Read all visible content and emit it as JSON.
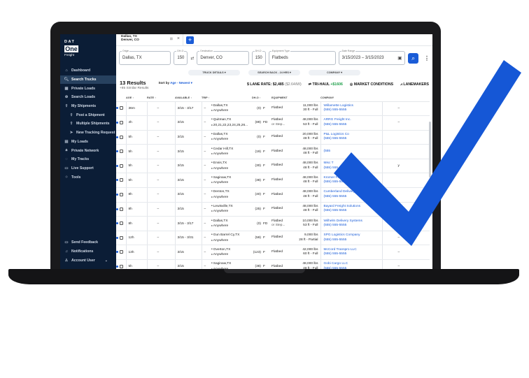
{
  "app": {
    "dat": "DAT",
    "one": "One",
    "freight": "Freight"
  },
  "sidebar": {
    "items": [
      {
        "label": "Dashboard",
        "icon": "home-icon",
        "glyph": "⌂"
      },
      {
        "label": "Search Trucks",
        "icon": "search-icon",
        "glyph": "🔍︎",
        "active": true
      },
      {
        "label": "Private Loads",
        "icon": "building-icon",
        "glyph": "▦"
      },
      {
        "label": "Search Loads",
        "icon": "search-loads-icon",
        "glyph": "⊕"
      },
      {
        "label": "My Shipments",
        "icon": "upload-icon",
        "glyph": "⇧"
      },
      {
        "label": "Post a Shipment",
        "icon": "upload-icon",
        "glyph": "⇧",
        "sub": true
      },
      {
        "label": "Multiple Shipments",
        "icon": "upload-icon",
        "glyph": "⇧",
        "sub": true
      },
      {
        "label": "New Tracking Request",
        "icon": "send-icon",
        "glyph": "➤",
        "sub": true
      },
      {
        "label": "My Loads",
        "icon": "truck-icon",
        "glyph": "▤"
      },
      {
        "label": "Private Network",
        "icon": "lock-icon",
        "glyph": "🔒︎"
      },
      {
        "label": "My Tracks",
        "icon": "tracks-icon",
        "glyph": "◌"
      },
      {
        "label": "Live Support",
        "icon": "chat-icon",
        "glyph": "▭"
      },
      {
        "label": "Tools",
        "icon": "tools-icon",
        "glyph": "⁘"
      }
    ],
    "bottom": [
      {
        "label": "Send Feedback",
        "icon": "feedback-icon",
        "glyph": "▭"
      },
      {
        "label": "Notifications",
        "icon": "bell-icon",
        "glyph": "♫"
      },
      {
        "label": "Account User",
        "icon": "user-icon",
        "glyph": "♙"
      }
    ]
  },
  "tab": {
    "origin": "Dallas, TX",
    "destination": "Denver, CO"
  },
  "search": {
    "origin_label": "Origin",
    "origin": "Dallas, TX",
    "dho_label": "DH-O",
    "dho": "150",
    "destination_label": "Destination",
    "destination": "Denver, CO",
    "dhd_label": "DH-D",
    "dhd": "150",
    "equipment_label": "Equipment Type",
    "equipment": "Flatbeds",
    "date_label": "Date Range",
    "date": "3/15/2023 – 3/15/2023"
  },
  "chips": [
    "TRUCK DETAILS ▾",
    "SEARCH BACK - 24 HRS ▾",
    "COMPANY ▾"
  ],
  "results": {
    "count": "13 Results",
    "similar": "+85 Similar Results",
    "sort_prefix": "Sort by",
    "sort_value": "Age - Newest ▾",
    "lane_rate_prefix": "$ LANE RATE:",
    "lane_rate": "$2,485",
    "lane_rate_per_mile": "($2.64/MI)",
    "tri_haul_prefix": "⇄ TRI-HAUL",
    "tri_haul": "+$1606",
    "market": "◎ MARKET CONDITIONS",
    "lanemakers": "⩘ LANEMAKERS"
  },
  "columns": {
    "age": "AGE ↑",
    "rate": "RATE ↑",
    "available": "AVAILABLE ↑",
    "trip": "TRIP ↑",
    "dho": "DH-O ↑",
    "equipment": "EQUIPMENT",
    "company": "COMPANY"
  },
  "rows": [
    {
      "age": "36m",
      "rate": "–",
      "avail": "3/15 - 3/17",
      "trip": "–",
      "origin": "Dallas,TX",
      "dest": "Anywhere",
      "dho": "(0)",
      "eq": "F",
      "eqname": "Flatbed",
      "eqname2": "",
      "w1": "11,000 lbs",
      "w2": "30 ft - Full",
      "company": "Willamette Logistics",
      "phone": "(555) 555-5555",
      "last": "–"
    },
    {
      "age": "4h",
      "rate": "–",
      "avail": "3/15",
      "trip": "–",
      "origin": "Quitman,TX",
      "dest": "20,21,22,23,24,25,26...",
      "dho": "(89)",
      "eq": "FD",
      "eqname": "Flatbed",
      "eqname2": "or Step...",
      "w1": "48,000 lbs",
      "w2": "53 ft - Full",
      "company": "ARRG Freight Inc.",
      "phone": "(555) 555-5555",
      "last": "–"
    },
    {
      "age": "5h",
      "rate": "–",
      "avail": "3/15",
      "trip": "–",
      "origin": "Dallas,TX",
      "dest": "Anywhere",
      "dho": "(0)",
      "eq": "F",
      "eqname": "Flatbed",
      "eqname2": "",
      "w1": "20,000 lbs",
      "w2": "48 ft - Full",
      "company": "P&L Logistics Co",
      "phone": "(555) 555-5555",
      "last": ""
    },
    {
      "age": "5h",
      "rate": "–",
      "avail": "3/15",
      "trip": "–",
      "origin": "Cedar Hill,TX",
      "dest": "Anywhere",
      "dho": "(19)",
      "eq": "F",
      "eqname": "Flatbed",
      "eqname2": "",
      "w1": "48,000 lbs",
      "w2": "48 ft - Full",
      "company": "",
      "phone": "(555",
      "last": ""
    },
    {
      "age": "5h",
      "rate": "–",
      "avail": "3/15",
      "trip": "–",
      "origin": "Ennis,TX",
      "dest": "Anywhere",
      "dho": "(30)",
      "eq": "F",
      "eqname": "Flatbed",
      "eqname2": "",
      "w1": "48,000 lbs",
      "w2": "48 ft - Full",
      "company": "Misc T",
      "phone": "(555) 555",
      "last": "y"
    },
    {
      "age": "5h",
      "rate": "–",
      "avail": "3/15",
      "trip": "–",
      "origin": "Saginaw,TX",
      "dest": "Anywhere",
      "dho": "(38)",
      "eq": "F",
      "eqname": "Flatbed",
      "eqname2": "",
      "w1": "48,000 lbs",
      "w2": "48 ft - Full",
      "company": "Kromer Freight",
      "phone": "(555) 555-5555",
      "last": ""
    },
    {
      "age": "8h",
      "rate": "–",
      "avail": "3/15",
      "trip": "–",
      "origin": "Denton,TX",
      "dest": "Anywhere",
      "dho": "(40)",
      "eq": "F",
      "eqname": "Flatbed",
      "eqname2": "",
      "w1": "48,000 lbs",
      "w2": "48 ft - Full",
      "company": "Cumberland Delivery C",
      "phone": "(555) 555-5555",
      "last": ""
    },
    {
      "age": "8h",
      "rate": "–",
      "avail": "3/15",
      "trip": "–",
      "origin": "Lewisville,TX",
      "dest": "Anywhere",
      "dho": "(25)",
      "eq": "F",
      "eqname": "Flatbed",
      "eqname2": "",
      "w1": "48,000 lbs",
      "w2": "48 ft - Full",
      "company": "Bayard Freight Solutions",
      "phone": "(555) 555-5555",
      "last": ""
    },
    {
      "age": "8h",
      "rate": "–",
      "avail": "3/15 - 3/17",
      "trip": "–",
      "origin": "Dallas,TX",
      "dest": "Anywhere",
      "dho": "(0)",
      "eq": "FD",
      "eqname": "Flatbed",
      "eqname2": "or Step...",
      "w1": "10,000 lbs",
      "w2": "53 ft - Full",
      "company": "Wilhelm Delivery Systems",
      "phone": "(555) 555-5555",
      "last": ""
    },
    {
      "age": "12h",
      "rate": "–",
      "avail": "3/15 - 3/31",
      "trip": "–",
      "origin": "Gun Barrel Cy,TX",
      "dest": "Anywhere",
      "dho": "(59)",
      "eq": "F",
      "eqname": "Flatbed",
      "eqname2": "",
      "w1": "9,000 lbs",
      "w2": "28 ft - Partial",
      "company": "SPG Logistics Company",
      "phone": "(555) 555-5555",
      "last": "–"
    },
    {
      "age": "13h",
      "rate": "–",
      "avail": "3/15",
      "trip": "–",
      "origin": "Overton,TX",
      "dest": "Anywhere",
      "dho": "(123)",
      "eq": "F",
      "eqname": "Flatbed",
      "eqname2": "",
      "w1": "42,000 lbs",
      "w2": "60 ft - Full",
      "company": "McCord Transpro LLC",
      "phone": "(555) 555-5555",
      "last": "–"
    },
    {
      "age": "5h",
      "rate": "–",
      "avail": "3/15",
      "trip": "–",
      "origin": "Saginaw,TX",
      "dest": "Anywhere",
      "dho": "(38)",
      "eq": "F",
      "eqname": "Flatbed",
      "eqname2": "",
      "w1": "48,000 lbs",
      "w2": "48 ft - Full",
      "company": "Gobi Cargo LLC",
      "phone": "(555) 555-5555",
      "last": "–"
    }
  ],
  "colors": {
    "accent": "#1a5cd7",
    "sidebar": "#0b1d36",
    "check": "#1557d6",
    "green": "#1e9f4a"
  }
}
